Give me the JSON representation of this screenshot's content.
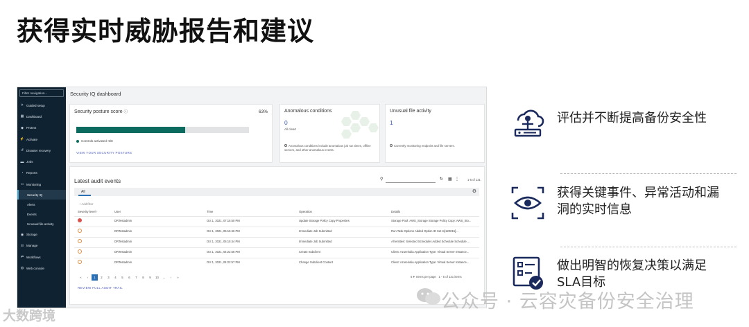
{
  "slide": {
    "title": "获得实时威胁报告和建议"
  },
  "sidebar": {
    "filter_placeholder": "Filter navigation...",
    "items": [
      {
        "label": "Guided setup",
        "icon": "rocket-icon"
      },
      {
        "label": "Dashboard",
        "icon": "dashboard-icon"
      },
      {
        "label": "Protect",
        "icon": "shield-icon"
      },
      {
        "label": "Activate",
        "icon": "bolt-icon"
      },
      {
        "label": "Disaster recovery",
        "icon": "recovery-icon"
      },
      {
        "label": "Jobs",
        "icon": "briefcase-icon"
      },
      {
        "label": "Reports",
        "icon": "report-icon"
      },
      {
        "label": "Monitoring",
        "icon": "monitor-icon"
      }
    ],
    "sub_items": [
      "Security IQ",
      "Alerts",
      "Events",
      "Unusual file activity"
    ],
    "items_after": [
      {
        "label": "Storage",
        "icon": "storage-icon"
      },
      {
        "label": "Manage",
        "icon": "manage-icon"
      },
      {
        "label": "Workflows",
        "icon": "workflow-icon"
      },
      {
        "label": "Web console",
        "icon": "globe-icon"
      }
    ]
  },
  "dashboard": {
    "title": "Security IQ dashboard",
    "posture": {
      "title": "Security posture score",
      "percent": "63%",
      "progress": 0.63,
      "controls": "Controls activated: 5/8",
      "link": "VIEW YOUR SECURITY POSTURE"
    },
    "anomalous": {
      "title": "Anomalous conditions",
      "count": "0",
      "status": "All clear!",
      "note": "Anomalous conditions include anomalous job run times, offline servers, and other anomalous events."
    },
    "unusual": {
      "title": "Unusual file activity",
      "count": "1",
      "note": "Currently monitoring endpoint and file servers."
    },
    "audit": {
      "title": "Latest audit events",
      "range": "1-5 of 131",
      "tab": "All",
      "add_filter": "+ Add filter",
      "columns": [
        "Severity level",
        "User",
        "Time",
        "Operation",
        "Details"
      ],
      "rows": [
        {
          "severity": "critical",
          "user": "DRTestadmin",
          "time": "Oct 1, 2021, 07:15:50 PM",
          "operation": "Update Storage Policy Copy Properties",
          "details": "Storage Pool: AWS_Storage Storage Policy Copy: AWS_Sto..."
        },
        {
          "severity": "warning",
          "user": "DRTestadmin",
          "time": "Oct 1, 2021, 05:15:46 PM",
          "operation": "Immediate Job Submitted",
          "details": "Run Task Options Added Option ID Set to[120015]..."
        },
        {
          "severity": "warning",
          "user": "DRTestadmin",
          "time": "Oct 1, 2021, 05:15:44 PM",
          "operation": "Immediate Job Submitted",
          "details": "All entities: Selected Schedules Added Schedule Schedule ..."
        },
        {
          "severity": "warning",
          "user": "DRTestadmin",
          "time": "Oct 1, 2021, 04:22:58 PM",
          "operation": "Create Subclient",
          "details": "Client: Azureindia Application Type: Virtual Server Instance..."
        },
        {
          "severity": "warning",
          "user": "DRTestadmin",
          "time": "Oct 1, 2021, 04:22:57 PM",
          "operation": "Change Subclient Content",
          "details": "Client: Azureindia Application Type: Virtual Server Instance..."
        }
      ],
      "pages": [
        "«",
        "‹",
        "1",
        "2",
        "3",
        "4",
        "5",
        "6",
        "7",
        "8",
        "9",
        "10",
        "...",
        "›",
        "»"
      ],
      "current_page": "1",
      "per_page": "5",
      "per_page_label": "Items per page",
      "page_range": "1 - 5 of 131 items",
      "review_link": "REVIEW FULL AUDIT TRAIL"
    }
  },
  "features": [
    {
      "icon": "cloud-server-icon",
      "lines": [
        "评估并不断提高备份安全性"
      ]
    },
    {
      "icon": "eye-scan-icon",
      "lines": [
        "获得关键事件、异常活动和漏",
        "洞的实时信息"
      ]
    },
    {
      "icon": "checklist-icon",
      "lines": [
        "做出明智的恢复决策以满足",
        "SLA目标"
      ]
    }
  ],
  "watermark": "公众号 · 云容灾备份安全治理",
  "brand": "大数跨境",
  "colors": {
    "accent_teal": "#0b6b5f",
    "sidebar_bg": "#0f2231",
    "link_blue": "#4b5bbf",
    "icon_navy": "#1b2a5c"
  }
}
